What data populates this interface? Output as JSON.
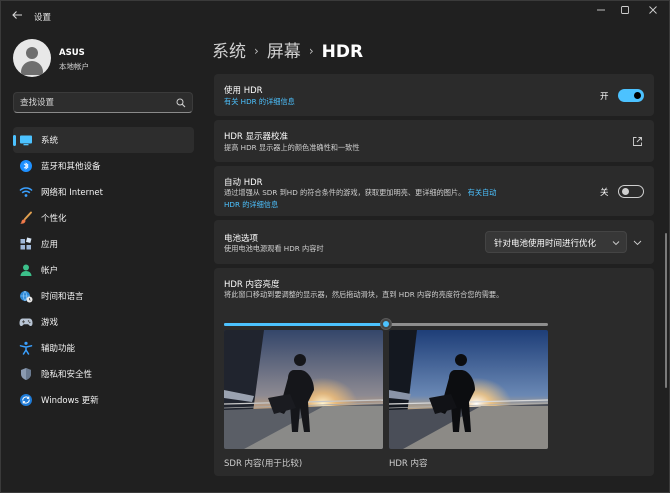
{
  "titlebar": {
    "title": "设置"
  },
  "profile": {
    "name": "ASUS",
    "account_type": "本地帐户"
  },
  "search": {
    "placeholder": "查找设置"
  },
  "sidebar": {
    "items": [
      {
        "label": "系统",
        "icon": "system-icon",
        "active": true
      },
      {
        "label": "蓝牙和其他设备",
        "icon": "bluetooth-icon"
      },
      {
        "label": "网络和 Internet",
        "icon": "wifi-icon"
      },
      {
        "label": "个性化",
        "icon": "brush-icon"
      },
      {
        "label": "应用",
        "icon": "apps-icon"
      },
      {
        "label": "帐户",
        "icon": "account-icon"
      },
      {
        "label": "时间和语言",
        "icon": "globe-clock-icon"
      },
      {
        "label": "游戏",
        "icon": "gamepad-icon"
      },
      {
        "label": "辅助功能",
        "icon": "accessibility-icon"
      },
      {
        "label": "隐私和安全性",
        "icon": "shield-icon"
      },
      {
        "label": "Windows 更新",
        "icon": "update-icon"
      }
    ]
  },
  "breadcrumb": {
    "parent1": "系统",
    "parent2": "屏幕",
    "current": "HDR"
  },
  "use_hdr": {
    "title": "使用 HDR",
    "link": "有关 HDR 的详细信息",
    "state_label": "开",
    "on": true
  },
  "calibration": {
    "title": "HDR 显示器校准",
    "description": "提高 HDR 显示器上的颜色准确性和一致性"
  },
  "auto_hdr": {
    "title": "自动 HDR",
    "description": "通过增强从 SDR 到HD 的符合条件的游戏，获取更加明亮、更详细的图片。",
    "link_part1": "有关自动",
    "link_part2": "HDR 的详细信息",
    "state_label": "关",
    "on": false
  },
  "battery": {
    "title": "电池选项",
    "description": "使用电池电源观看 HDR 内容时",
    "selected": "针对电池使用时间进行优化"
  },
  "brightness": {
    "title": "HDR 内容亮度",
    "description": "将此窗口移动到要调整的显示器，然后拖动滑块，直到 HDR 内容的亮度符合您的需要。",
    "slider_value": 0.5,
    "sdr_label": "SDR 内容(用于比较)",
    "hdr_label": "HDR 内容"
  },
  "colors": {
    "accent": "#4cc2ff",
    "background": "#202020",
    "card": "#2b2b2b"
  }
}
